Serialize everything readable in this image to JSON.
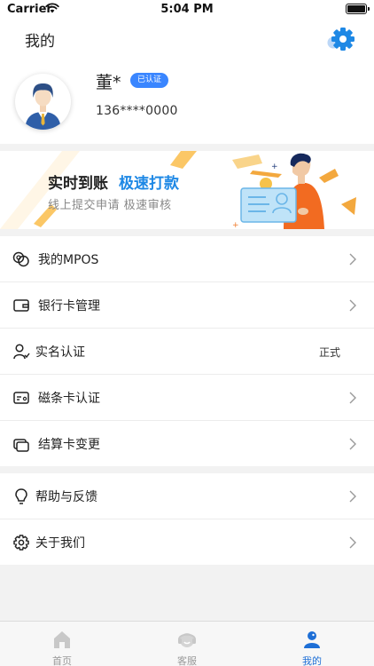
{
  "status_bar": {
    "carrier": "Carrier",
    "time": "5:04 PM"
  },
  "nav": {
    "title": "我的",
    "settings_icon": "gear-icon"
  },
  "profile": {
    "name": "董*",
    "badge": "已认证",
    "phone": "136****0000"
  },
  "banner": {
    "title_a": "实时到账",
    "title_b": "极速打款",
    "subtitle": "线上提交申请 极速审核"
  },
  "menu": {
    "group1": [
      {
        "label": "我的MPOS",
        "icon": "mpos-icon"
      },
      {
        "label": "银行卡管理",
        "icon": "wallet-icon"
      },
      {
        "label": "实名认证",
        "icon": "user-verify-icon",
        "value": "正式"
      },
      {
        "label": "磁条卡认证",
        "icon": "card-icon"
      },
      {
        "label": "结算卡变更",
        "icon": "cards-change-icon"
      }
    ],
    "group2": [
      {
        "label": "帮助与反馈",
        "icon": "bulb-icon"
      },
      {
        "label": "关于我们",
        "icon": "gear-icon"
      }
    ]
  },
  "tabbar": {
    "tabs": [
      {
        "label": "首页",
        "icon": "home-icon"
      },
      {
        "label": "客服",
        "icon": "customer-service-icon"
      },
      {
        "label": "我的",
        "icon": "profile-icon"
      }
    ],
    "active_color": "#1e6fd6",
    "inactive_color": "#999999"
  },
  "colors": {
    "accent": "#1e88e5",
    "badge": "#3a86ff"
  }
}
